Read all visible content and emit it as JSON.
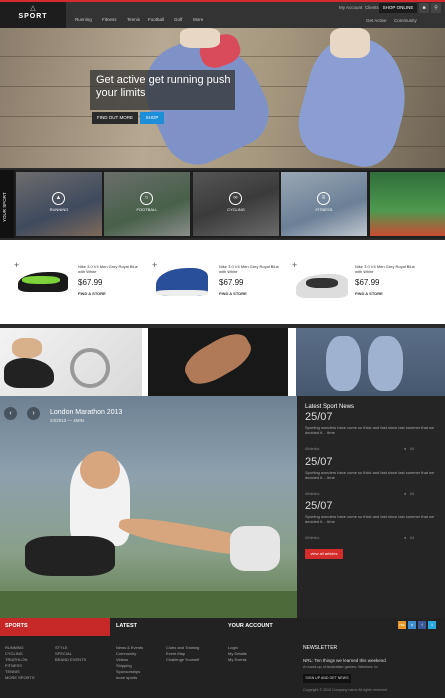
{
  "brand": {
    "name": "SPORT",
    "mark": "△"
  },
  "topnav": {
    "items": [
      "Running",
      "Fitness",
      "Tennis",
      "Football",
      "Golf",
      "More"
    ]
  },
  "utility": {
    "links": [
      "My Account",
      "Clients",
      "Get Active",
      "Community"
    ],
    "shop_label": "SHOP ONLINE",
    "cart_icon": "cart-icon",
    "search_icon": "search-icon"
  },
  "hero": {
    "title": "Get active get running push your limits",
    "more_label": "FIND OUT MORE",
    "shop_label": "SHOP"
  },
  "categories": {
    "side_label": "YOUR SPORT",
    "items": [
      {
        "label": "RUNNING",
        "icon": "runner-icon"
      },
      {
        "label": "FOOTBALL",
        "icon": "ball-icon"
      },
      {
        "label": "CYCLING",
        "icon": "bike-icon"
      },
      {
        "label": "FITNESS",
        "icon": "dumbbell-icon"
      },
      {
        "label": "",
        "icon": ""
      }
    ]
  },
  "products": [
    {
      "name": "Nike 3.0 V4 Men Grey Royal Blue with White",
      "price": "$67.99",
      "store": "FIND A STORE"
    },
    {
      "name": "Nike 3.0 V4 Men Grey Royal Blue with White",
      "price": "$67.99",
      "store": "FIND A STORE"
    },
    {
      "name": "Nike 3.0 V4 Men Grey Royal Blue with White",
      "price": "$67.99",
      "store": "FIND A STORE"
    }
  ],
  "feature": {
    "title": "London Marathon 2013",
    "meta": "24/2013 — 4MIN"
  },
  "news": {
    "heading": "Latest Sport News",
    "items": [
      {
        "date": "25/07",
        "text": "Sporting wonders have come so thick and fast since last summer that we decided it… time",
        "meta": "Athletics",
        "count": "84"
      },
      {
        "date": "25/07",
        "text": "Sporting wonders have come so thick and fast since last summer that we decided it… time",
        "meta": "Athletics",
        "count": "84"
      },
      {
        "date": "25/07",
        "text": "Sporting wonders have come so thick and fast since last summer that we decided it… time",
        "meta": "Athletics",
        "count": "84"
      }
    ],
    "all_label": "view all articles"
  },
  "footer": {
    "sports_heading": "SPORTS",
    "sports_col1": [
      "RUNNING",
      "CYCLING",
      "TRIATHLON",
      "FITNESS",
      "TENNIS",
      "MORE SPORTS"
    ],
    "sports_col2": [
      "STYLE",
      "SPECIAL",
      "BRAND EVENTS"
    ],
    "latest_heading": "LATEST",
    "latest_col1": [
      "News & Events",
      "Community",
      "Videos",
      "Shipping",
      "Sponsorships",
      "more sports"
    ],
    "latest_col2": [
      "Clubs and Training",
      "Event Map",
      "Challenge Yourself"
    ],
    "account_heading": "YOUR ACCOUNT",
    "account_links": [
      "Login",
      "My Details",
      "My Events"
    ],
    "newsletter_heading": "NEWSLETTER",
    "newsletter_text": "NRL: Ten things we learned this weekend",
    "newsletter_sub": "A round-up of Australian games: Warriors, to",
    "signup_label": "SIGN UP AND GET NEWS",
    "copyright": "Copyright © 2013 Company name All rights reserved",
    "social": [
      "rss",
      "s",
      "f",
      "t"
    ]
  },
  "colors": {
    "accent": "#d42b2b",
    "shop": "#1d8ed8",
    "dark": "#2b2b2b"
  }
}
